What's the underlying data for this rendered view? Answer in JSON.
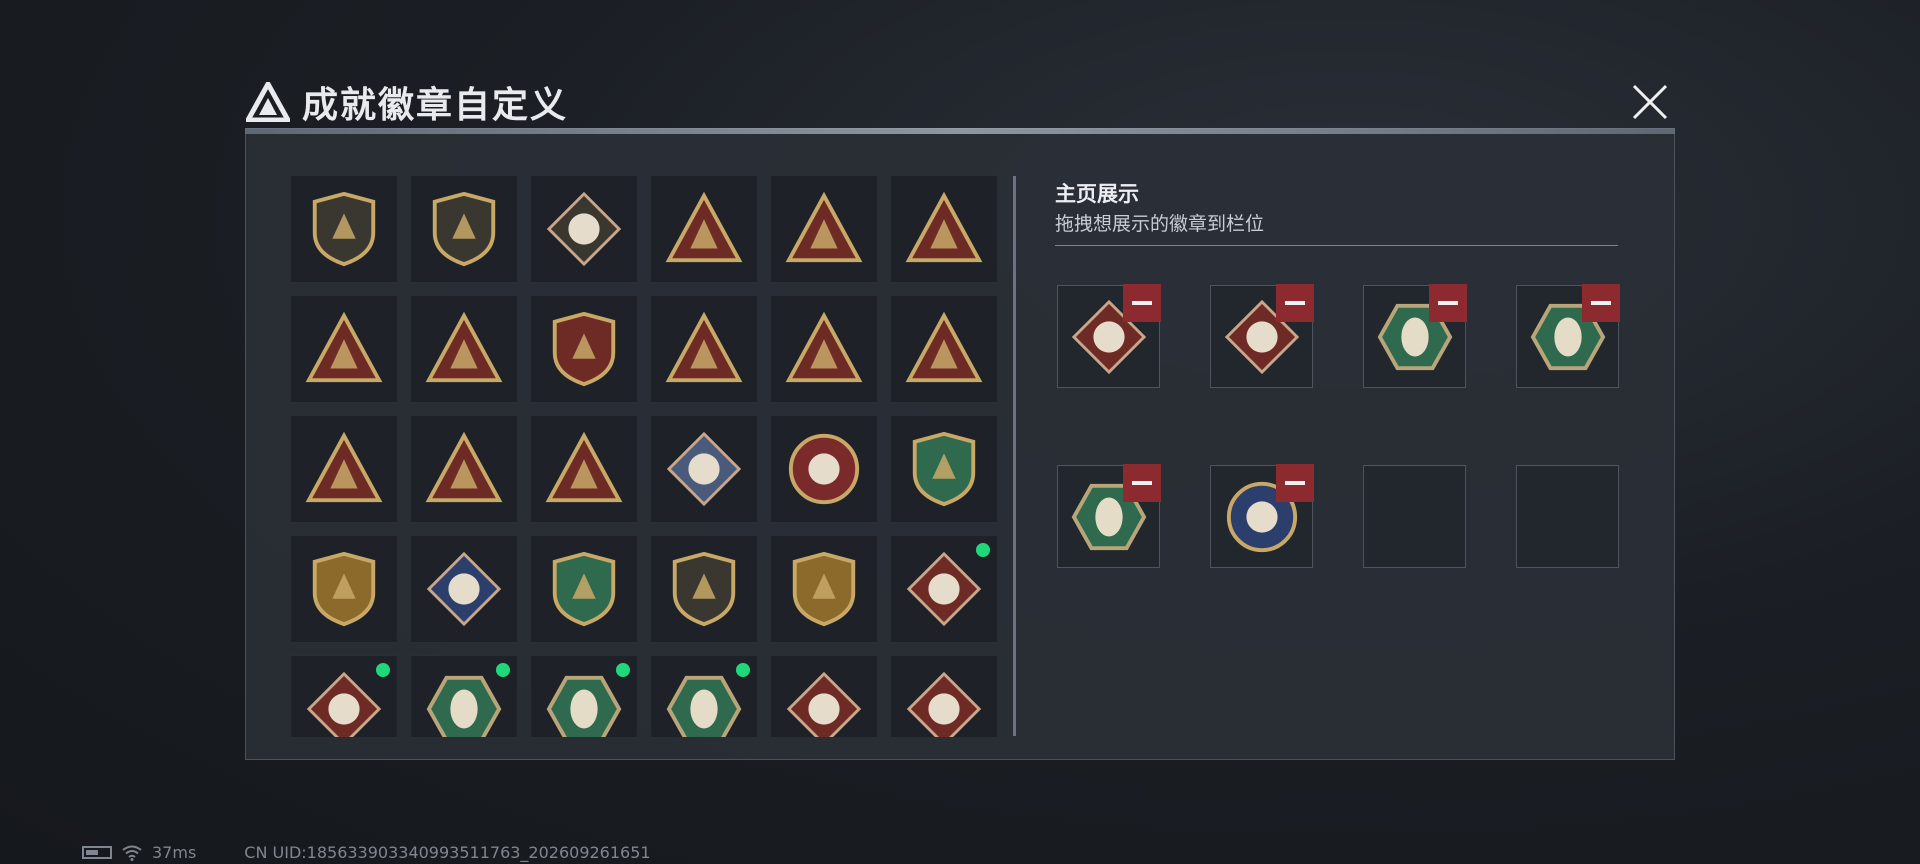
{
  "header": {
    "title": "成就徽章自定义",
    "close_icon": "close-icon",
    "logo_icon": "triangle-logo-icon"
  },
  "colors": {
    "panel_bg": "#2a2f36",
    "gold": "#c8a867",
    "dark_red": "#6e2a24",
    "green": "#2f6a4f",
    "remove_red": "#8c2a2f",
    "new_dot": "#1fd87a"
  },
  "badge_grid": {
    "rows": [
      [
        {
          "icon": "shield-logo-badge",
          "new": false
        },
        {
          "icon": "helicopter-shield-badge",
          "new": false
        },
        {
          "icon": "diamond-emblem-shield-badge",
          "new": false
        },
        {
          "icon": "radar-dish-triangle-badge",
          "new": false
        },
        {
          "icon": "s4-tank-triangle-badge",
          "new": false
        },
        {
          "icon": "s6-triangle-badge",
          "new": false
        }
      ],
      [
        {
          "icon": "s8-pack-triangle-badge",
          "new": false
        },
        {
          "icon": "s9-drone-triangle-badge",
          "new": false
        },
        {
          "icon": "crossed-rifles-soldier-badge",
          "new": false
        },
        {
          "icon": "boat-triangle-badge",
          "new": false
        },
        {
          "icon": "wasp-triangle-badge",
          "new": false
        },
        {
          "icon": "number-one-triangle-badge",
          "new": false
        }
      ],
      [
        {
          "icon": "number-two-triangle-badge",
          "new": false
        },
        {
          "icon": "squad-triangle-badge",
          "new": false
        },
        {
          "icon": "missile-triangle-badge",
          "new": false
        },
        {
          "icon": "rose-diamond-badge",
          "new": false
        },
        {
          "icon": "star-compass-medal-badge",
          "new": false
        },
        {
          "icon": "green-star-shield-badge",
          "new": false
        }
      ],
      [
        {
          "icon": "red-star-shield-badge",
          "new": false
        },
        {
          "icon": "diamond-crest-badge",
          "new": false
        },
        {
          "icon": "green-crosshair-rifle-badge",
          "new": false
        },
        {
          "icon": "dark-crosshair-rifle-badge",
          "new": false
        },
        {
          "icon": "gold-missile-star-badge",
          "new": false
        },
        {
          "icon": "wolf-diamond-badge",
          "new": true
        }
      ],
      [
        {
          "icon": "wolf-diamond-badge",
          "new": true
        },
        {
          "icon": "wasp-hexagon-badge",
          "new": true
        },
        {
          "icon": "wasp-hexagon-badge",
          "new": true
        },
        {
          "icon": "hammer-hexagon-badge",
          "new": true
        },
        {
          "icon": "dragon-diamond-badge",
          "new": false
        },
        {
          "icon": "runner-diamond-badge",
          "new": false
        }
      ]
    ]
  },
  "showcase": {
    "title": "主页展示",
    "subtitle": "拖拽想展示的徽章到栏位",
    "remove_icon": "minus-icon",
    "slots": [
      {
        "icon": "wolf-diamond-badge",
        "filled": true
      },
      {
        "icon": "wolf-diamond-badge",
        "filled": true
      },
      {
        "icon": "wasp-hexagon-badge",
        "filled": true
      },
      {
        "icon": "wasp-hexagon-badge",
        "filled": true
      },
      {
        "icon": "hammer-hexagon-badge",
        "filled": true
      },
      {
        "icon": "lynx-round-badge",
        "filled": true
      },
      {
        "icon": "",
        "filled": false
      },
      {
        "icon": "",
        "filled": false
      }
    ]
  },
  "status_bar": {
    "battery_icon": "battery-icon",
    "wifi_icon": "wifi-icon",
    "ping": "37ms",
    "uid": "CN UID:18563390334099351176​3_202609261651"
  }
}
